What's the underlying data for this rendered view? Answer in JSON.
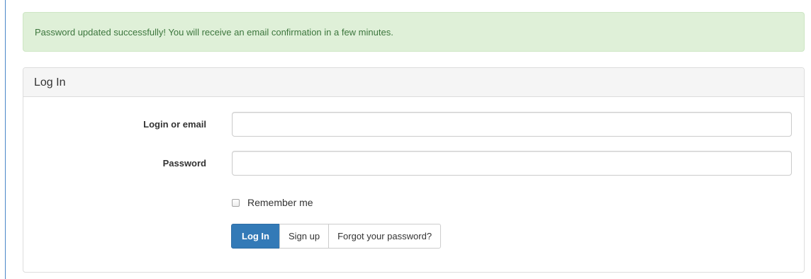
{
  "alert": {
    "message": "Password updated successfully! You will receive an email confirmation in a few minutes."
  },
  "panel": {
    "title": "Log In"
  },
  "form": {
    "login_label": "Login or email",
    "login_value": "",
    "password_label": "Password",
    "password_value": "",
    "remember_label": "Remember me",
    "remember_checked": false
  },
  "buttons": {
    "login": "Log In",
    "signup": "Sign up",
    "forgot": "Forgot your password?"
  },
  "colors": {
    "alert_bg": "#dff0d8",
    "alert_text": "#3c763d",
    "primary": "#337ab7",
    "panel_heading_bg": "#f5f5f5"
  }
}
